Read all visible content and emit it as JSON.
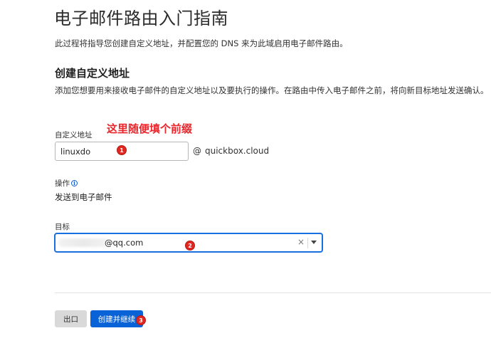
{
  "header": {
    "title": "电子邮件路由入门指南",
    "intro": "此过程将指导您创建自定义地址，并配置您的 DNS 来为此域启用电子邮件路由。"
  },
  "section": {
    "title": "创建自定义地址",
    "description": "添加您想要用来接收电子邮件的自定义地址以及要执行的操作。在路由中传入电子邮件之前，将向新目标地址发送确认。"
  },
  "annotation": "这里随便填个前缀",
  "custom_address": {
    "label": "自定义地址",
    "value": "linuxdo",
    "at": "@",
    "domain": "quickbox.cloud"
  },
  "action": {
    "label": "操作",
    "info_icon": "info-icon",
    "value": "发送到电子邮件"
  },
  "destination": {
    "label": "目标",
    "value": "@qq.com",
    "clear_glyph": "×"
  },
  "buttons": {
    "cancel": "出口",
    "primary": "创建并继续"
  },
  "markers": [
    "1",
    "2",
    "3"
  ],
  "colors": {
    "accent": "#0a63d6",
    "focus_border": "#1a6fe0",
    "annotation": "#e8262b",
    "marker": "#e02820"
  }
}
